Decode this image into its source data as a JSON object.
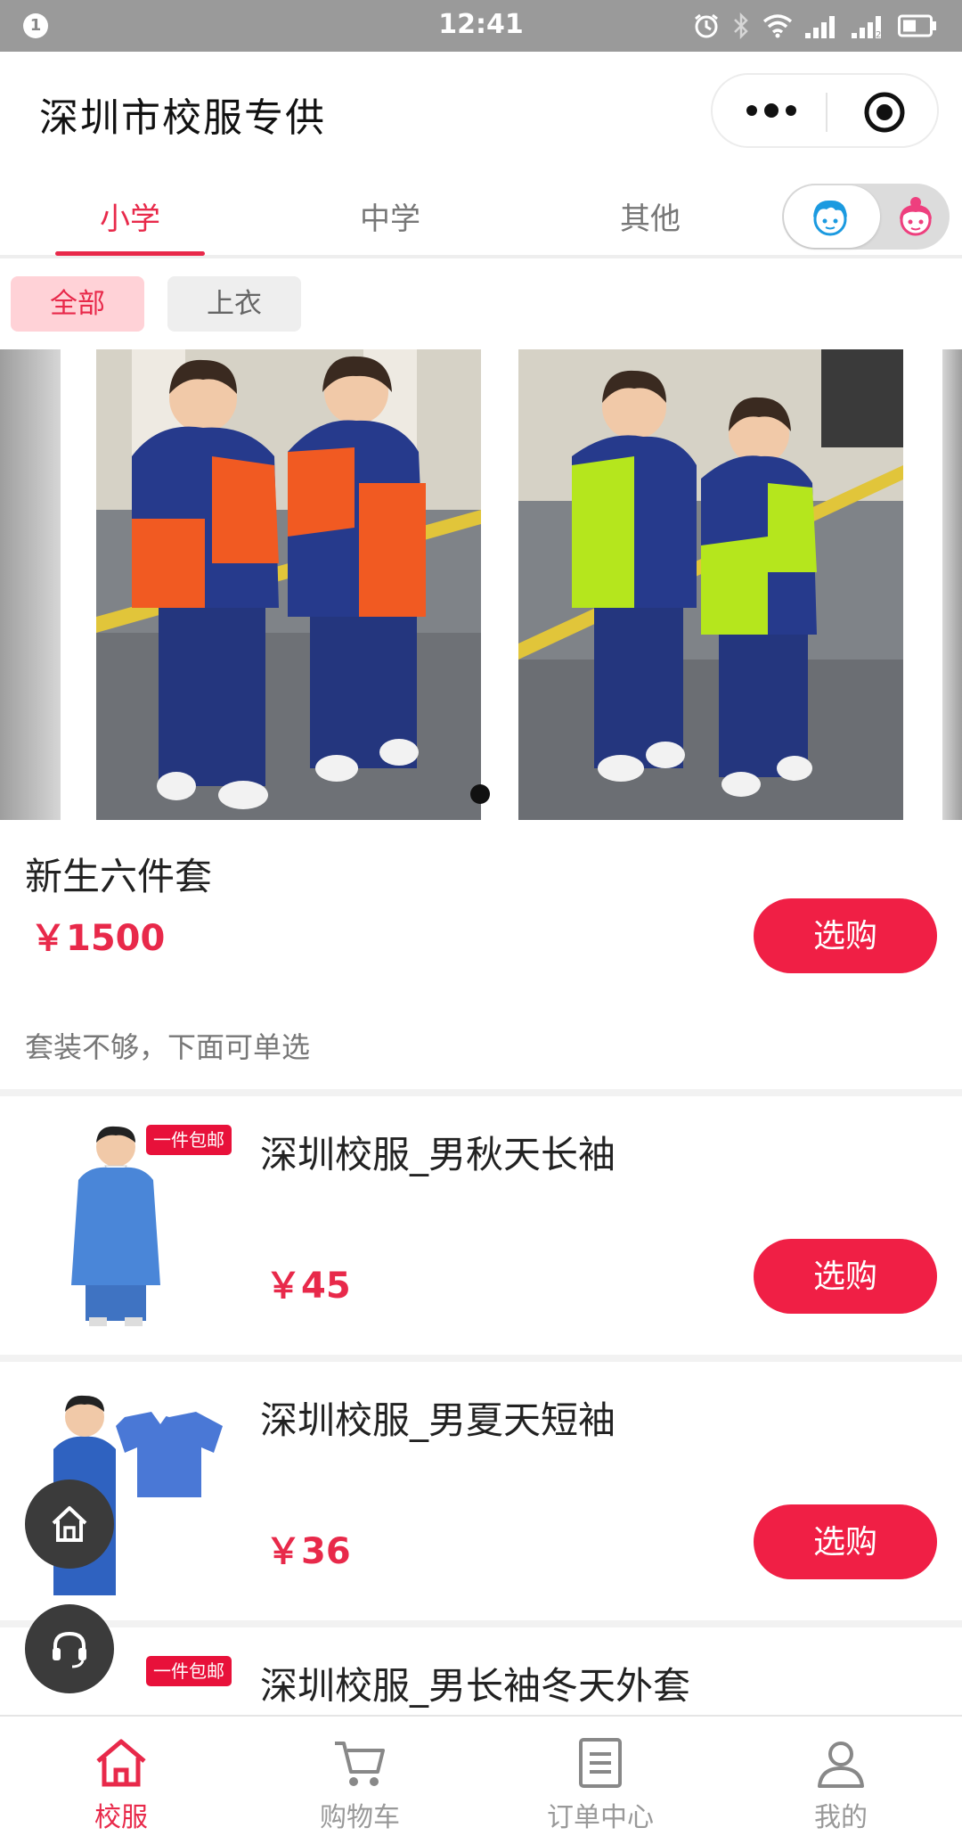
{
  "status_bar": {
    "notification_count": "1",
    "time": "12:41",
    "sim2_label": "2"
  },
  "header": {
    "title": "深圳市校服专供"
  },
  "tabs": [
    {
      "label": "小学",
      "active": true
    },
    {
      "label": "中学",
      "active": false
    },
    {
      "label": "其他",
      "active": false
    }
  ],
  "filters": [
    {
      "label": "全部",
      "active": true
    },
    {
      "label": "上衣",
      "active": false
    }
  ],
  "featured": {
    "name": "新生六件套",
    "price": "￥1500",
    "buy_label": "选购",
    "hint": "套装不够，下面可单选"
  },
  "products": [
    {
      "name": "深圳校服_男秋天长袖",
      "price": "￥45",
      "badge": "一件包邮",
      "buy_label": "选购"
    },
    {
      "name": "深圳校服_男夏天短袖",
      "price": "￥36",
      "badge": "",
      "buy_label": "选购"
    },
    {
      "name": "深圳校服_男长袖冬天外套",
      "price": "",
      "badge": "一件包邮",
      "buy_label": ""
    }
  ],
  "bottom_nav": [
    {
      "label": "校服",
      "icon": "home-icon",
      "active": true
    },
    {
      "label": "购物车",
      "icon": "cart-icon",
      "active": false
    },
    {
      "label": "订单中心",
      "icon": "order-list-icon",
      "active": false
    },
    {
      "label": "我的",
      "icon": "user-icon",
      "active": false
    }
  ],
  "colors": {
    "accent": "#e8294a",
    "button": "#f01f45",
    "badge": "#e8113a"
  }
}
